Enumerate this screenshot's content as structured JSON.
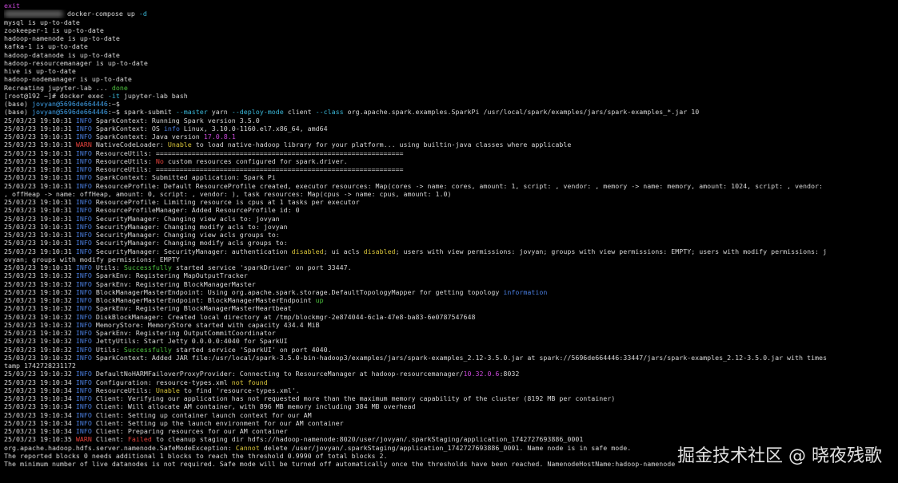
{
  "colors": {
    "default": "#d6d6d6",
    "cyan": "#3ab8d8",
    "blue": "#4a7ee0",
    "green": "#4ec23f",
    "red": "#e2413b",
    "yellow": "#d8c43a",
    "magenta": "#c848d8",
    "prompt": "#3f9fe6"
  },
  "watermark": "掘金技术社区 @ 晓夜残歌",
  "lines": [
    [
      [
        "exit",
        "magenta"
      ]
    ],
    [
      [
        "",
        "blur"
      ],
      [
        " docker-compose up ",
        "default"
      ],
      [
        "-d",
        "cyan"
      ]
    ],
    [
      [
        "mysql is up-to-date",
        "default"
      ]
    ],
    [
      [
        "zookeeper-1 is up-to-date",
        "default"
      ]
    ],
    [
      [
        "hadoop-namenode is up-to-date",
        "default"
      ]
    ],
    [
      [
        "kafka-1 is up-to-date",
        "default"
      ]
    ],
    [
      [
        "hadoop-datanode is up-to-date",
        "default"
      ]
    ],
    [
      [
        "hadoop-resourcemanager is up-to-date",
        "default"
      ]
    ],
    [
      [
        "hive is up-to-date",
        "default"
      ]
    ],
    [
      [
        "hadoop-nodemanager is up-to-date",
        "default"
      ]
    ],
    [
      [
        "Recreating jupyter-lab ... ",
        "default"
      ],
      [
        "done",
        "green"
      ]
    ],
    [
      [
        "[root@192 ~]# docker exec ",
        "default"
      ],
      [
        "-it",
        "cyan"
      ],
      [
        " jupyter-lab bash",
        "default"
      ]
    ],
    [
      [
        "(base) ",
        "default"
      ],
      [
        "jovyan@5696de664446",
        "prompt"
      ],
      [
        ":~$",
        "default"
      ]
    ],
    [
      [
        "(base) ",
        "default"
      ],
      [
        "jovyan@5696de664446",
        "prompt"
      ],
      [
        ":~$ spark-submit ",
        "default"
      ],
      [
        "--master",
        "cyan"
      ],
      [
        " yarn ",
        "default"
      ],
      [
        "--deploy-mode",
        "cyan"
      ],
      [
        " client ",
        "default"
      ],
      [
        "--class",
        "cyan"
      ],
      [
        " org.apache.spark.examples.SparkPi /usr/local/spark/examples/jars/spark-examples_*.jar 10",
        "default"
      ]
    ],
    [
      [
        "25/03/23 19:10:31 ",
        "default"
      ],
      [
        "INFO",
        "blue"
      ],
      [
        " SparkContext: Running Spark version 3.5.0",
        "default"
      ]
    ],
    [
      [
        "25/03/23 19:10:31 ",
        "default"
      ],
      [
        "INFO",
        "blue"
      ],
      [
        " SparkContext: OS ",
        "default"
      ],
      [
        "info",
        "blue"
      ],
      [
        " Linux, 3.10.0-1160.el7.x86_64, amd64",
        "default"
      ]
    ],
    [
      [
        "25/03/23 19:10:31 ",
        "default"
      ],
      [
        "INFO",
        "blue"
      ],
      [
        " SparkContext: Java version ",
        "default"
      ],
      [
        "17.0.8.1",
        "magenta"
      ]
    ],
    [
      [
        "25/03/23 19:10:31 ",
        "default"
      ],
      [
        "WARN",
        "red"
      ],
      [
        " NativeCodeLoader: ",
        "default"
      ],
      [
        "Unable",
        "yellow"
      ],
      [
        " to load native-hadoop library for your platform... using builtin-java classes where applicable",
        "default"
      ]
    ],
    [
      [
        "25/03/23 19:10:31 ",
        "default"
      ],
      [
        "INFO",
        "blue"
      ],
      [
        " ResourceUtils: ==============================================================",
        "default"
      ]
    ],
    [
      [
        "25/03/23 19:10:31 ",
        "default"
      ],
      [
        "INFO",
        "blue"
      ],
      [
        " ResourceUtils: ",
        "default"
      ],
      [
        "No",
        "red"
      ],
      [
        " custom resources configured for spark.driver.",
        "default"
      ]
    ],
    [
      [
        "25/03/23 19:10:31 ",
        "default"
      ],
      [
        "INFO",
        "blue"
      ],
      [
        " ResourceUtils: ==============================================================",
        "default"
      ]
    ],
    [
      [
        "25/03/23 19:10:31 ",
        "default"
      ],
      [
        "INFO",
        "blue"
      ],
      [
        " SparkContext: Submitted application: Spark Pi",
        "default"
      ]
    ],
    [
      [
        "25/03/23 19:10:31 ",
        "default"
      ],
      [
        "INFO",
        "blue"
      ],
      [
        " ResourceProfile: Default ResourceProfile created, executor resources: Map(cores -> name: cores, amount: 1, script: , vendor: , memory -> name: memory, amount: 1024, script: , vendor:",
        "default"
      ]
    ],
    [
      [
        ", offHeap -> name: offHeap, amount: 0, script: , vendor: ), task resources: Map(cpus -> name: cpus, amount: 1.0)",
        "default"
      ]
    ],
    [
      [
        "25/03/23 19:10:31 ",
        "default"
      ],
      [
        "INFO",
        "blue"
      ],
      [
        " ResourceProfile: Limiting resource is cpus at 1 tasks per executor",
        "default"
      ]
    ],
    [
      [
        "25/03/23 19:10:31 ",
        "default"
      ],
      [
        "INFO",
        "blue"
      ],
      [
        " ResourceProfileManager: Added ResourceProfile id: 0",
        "default"
      ]
    ],
    [
      [
        "25/03/23 19:10:31 ",
        "default"
      ],
      [
        "INFO",
        "blue"
      ],
      [
        " SecurityManager: Changing view acls to: jovyan",
        "default"
      ]
    ],
    [
      [
        "25/03/23 19:10:31 ",
        "default"
      ],
      [
        "INFO",
        "blue"
      ],
      [
        " SecurityManager: Changing modify acls to: jovyan",
        "default"
      ]
    ],
    [
      [
        "25/03/23 19:10:31 ",
        "default"
      ],
      [
        "INFO",
        "blue"
      ],
      [
        " SecurityManager: Changing view acls groups to:",
        "default"
      ]
    ],
    [
      [
        "25/03/23 19:10:31 ",
        "default"
      ],
      [
        "INFO",
        "blue"
      ],
      [
        " SecurityManager: Changing modify acls groups to:",
        "default"
      ]
    ],
    [
      [
        "25/03/23 19:10:31 ",
        "default"
      ],
      [
        "INFO",
        "blue"
      ],
      [
        " SecurityManager: SecurityManager: authentication ",
        "default"
      ],
      [
        "disabled",
        "yellow"
      ],
      [
        "; ui acls ",
        "default"
      ],
      [
        "disabled",
        "yellow"
      ],
      [
        "; users with view permissions: jovyan; groups with view permissions: EMPTY; users with modify permissions: j",
        "default"
      ]
    ],
    [
      [
        "ovyan; groups with modify permissions: EMPTY",
        "default"
      ]
    ],
    [
      [
        "25/03/23 19:10:31 ",
        "default"
      ],
      [
        "INFO",
        "blue"
      ],
      [
        " Utils: ",
        "default"
      ],
      [
        "Successfully",
        "green"
      ],
      [
        " started service 'sparkDriver' on port 33447.",
        "default"
      ]
    ],
    [
      [
        "25/03/23 19:10:32 ",
        "default"
      ],
      [
        "INFO",
        "blue"
      ],
      [
        " SparkEnv: Registering MapOutputTracker",
        "default"
      ]
    ],
    [
      [
        "25/03/23 19:10:32 ",
        "default"
      ],
      [
        "INFO",
        "blue"
      ],
      [
        " SparkEnv: Registering BlockManagerMaster",
        "default"
      ]
    ],
    [
      [
        "25/03/23 19:10:32 ",
        "default"
      ],
      [
        "INFO",
        "blue"
      ],
      [
        " BlockManagerMasterEndpoint: Using org.apache.spark.storage.DefaultTopologyMapper for getting topology ",
        "default"
      ],
      [
        "information",
        "blue"
      ]
    ],
    [
      [
        "25/03/23 19:10:32 ",
        "default"
      ],
      [
        "INFO",
        "blue"
      ],
      [
        " BlockManagerMasterEndpoint: BlockManagerMasterEndpoint ",
        "default"
      ],
      [
        "up",
        "green"
      ]
    ],
    [
      [
        "25/03/23 19:10:32 ",
        "default"
      ],
      [
        "INFO",
        "blue"
      ],
      [
        " SparkEnv: Registering BlockManagerMasterHeartbeat",
        "default"
      ]
    ],
    [
      [
        "25/03/23 19:10:32 ",
        "default"
      ],
      [
        "INFO",
        "blue"
      ],
      [
        " DiskBlockManager: Created local directory at /tmp/blockmgr-2e874044-6c1a-47e8-ba83-6e0787547648",
        "default"
      ]
    ],
    [
      [
        "25/03/23 19:10:32 ",
        "default"
      ],
      [
        "INFO",
        "blue"
      ],
      [
        " MemoryStore: MemoryStore started with capacity 434.4 MiB",
        "default"
      ]
    ],
    [
      [
        "25/03/23 19:10:32 ",
        "default"
      ],
      [
        "INFO",
        "blue"
      ],
      [
        " SparkEnv: Registering OutputCommitCoordinator",
        "default"
      ]
    ],
    [
      [
        "25/03/23 19:10:32 ",
        "default"
      ],
      [
        "INFO",
        "blue"
      ],
      [
        " JettyUtils: Start Jetty 0.0.0.0:4040 for SparkUI",
        "default"
      ]
    ],
    [
      [
        "25/03/23 19:10:32 ",
        "default"
      ],
      [
        "INFO",
        "blue"
      ],
      [
        " Utils: ",
        "default"
      ],
      [
        "Successfully",
        "green"
      ],
      [
        " started service 'SparkUI' on port 4040.",
        "default"
      ]
    ],
    [
      [
        "25/03/23 19:10:32 ",
        "default"
      ],
      [
        "INFO",
        "blue"
      ],
      [
        " SparkContext: Added JAR file:/usr/local/spark-3.5.0-bin-hadoop3/examples/jars/spark-examples_2.12-3.5.0.jar at spark://5696de664446:33447/jars/spark-examples_2.12-3.5.0.jar with times",
        "default"
      ]
    ],
    [
      [
        "tamp 1742728231172",
        "default"
      ]
    ],
    [
      [
        "25/03/23 19:10:32 ",
        "default"
      ],
      [
        "INFO",
        "blue"
      ],
      [
        " DefaultNoHARMFailoverProxyProvider: Connecting to ResourceManager at hadoop-resourcemanager/",
        "default"
      ],
      [
        "10.32.0.6",
        "magenta"
      ],
      [
        ":8032",
        "default"
      ]
    ],
    [
      [
        "25/03/23 19:10:34 ",
        "default"
      ],
      [
        "INFO",
        "blue"
      ],
      [
        " Configuration: resource-types.xml ",
        "default"
      ],
      [
        "not found",
        "yellow"
      ]
    ],
    [
      [
        "25/03/23 19:10:34 ",
        "default"
      ],
      [
        "INFO",
        "blue"
      ],
      [
        " ResourceUtils: ",
        "default"
      ],
      [
        "Unable",
        "yellow"
      ],
      [
        " to find 'resource-types.xml'.",
        "default"
      ]
    ],
    [
      [
        "25/03/23 19:10:34 ",
        "default"
      ],
      [
        "INFO",
        "blue"
      ],
      [
        " Client: Verifying our application has not requested more than the maximum memory capability of the cluster (8192 MB per container)",
        "default"
      ]
    ],
    [
      [
        "25/03/23 19:10:34 ",
        "default"
      ],
      [
        "INFO",
        "blue"
      ],
      [
        " Client: Will allocate AM container, with 896 MB memory including 384 MB overhead",
        "default"
      ]
    ],
    [
      [
        "25/03/23 19:10:34 ",
        "default"
      ],
      [
        "INFO",
        "blue"
      ],
      [
        " Client: Setting up container launch context for our AM",
        "default"
      ]
    ],
    [
      [
        "25/03/23 19:10:34 ",
        "default"
      ],
      [
        "INFO",
        "blue"
      ],
      [
        " Client: Setting up the launch environment for our AM container",
        "default"
      ]
    ],
    [
      [
        "25/03/23 19:10:34 ",
        "default"
      ],
      [
        "INFO",
        "blue"
      ],
      [
        " Client: Preparing resources for our AM container",
        "default"
      ]
    ],
    [
      [
        "25/03/23 19:10:35 ",
        "default"
      ],
      [
        "WARN",
        "red"
      ],
      [
        " Client: ",
        "default"
      ],
      [
        "Failed",
        "red"
      ],
      [
        " to cleanup staging dir hdfs://hadoop-namenode:8020/user/jovyan/.sparkStaging/application_1742727693886_0001",
        "default"
      ]
    ],
    [
      [
        "org.apache.hadoop.hdfs.server.namenode.SafeModeException: ",
        "default"
      ],
      [
        "Cannot",
        "yellow"
      ],
      [
        " delete /user/jovyan/.sparkStaging/application_1742727693886_0001. Name node is in safe mode.",
        "default"
      ]
    ],
    [
      [
        "The reported blocks 0 needs additional 1 blocks to reach the threshold 0.9990 of total blocks 2.",
        "default"
      ]
    ],
    [
      [
        "The minimum number of live datanodes is not required. Safe mode will be turned off automatically once the thresholds have been reached. NamenodeHostName:hadoop-namenode",
        "default"
      ]
    ]
  ]
}
